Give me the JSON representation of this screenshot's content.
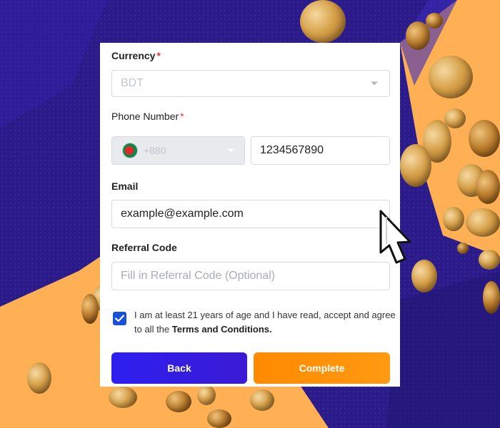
{
  "form": {
    "currency": {
      "label": "Currency",
      "required_mark": "*",
      "value": "BDT"
    },
    "phone": {
      "label": "Phone Number",
      "required_mark": "*",
      "dial_code": "+880",
      "value": "1234567890"
    },
    "email": {
      "label": "Email",
      "value": "example@example.com"
    },
    "referral": {
      "label": "Referral Code",
      "placeholder": "Fill in Referral Code (Optional)"
    },
    "agreement": {
      "checked": true,
      "text": "I am at least 21 years of age and I have read, accept and agree to all the ",
      "link": "Terms and Conditions."
    },
    "buttons": {
      "back": "Back",
      "complete": "Complete"
    }
  },
  "icons": [
    "chevron-down-icon",
    "bangladesh-flag-icon",
    "checkbox-check-icon",
    "hand-cursor-icon"
  ],
  "colors": {
    "primary": "#2d1ff0",
    "accent": "#ff8a00",
    "required": "#e53935",
    "background": "#2a1a8a",
    "gold": "#d7a14a"
  }
}
